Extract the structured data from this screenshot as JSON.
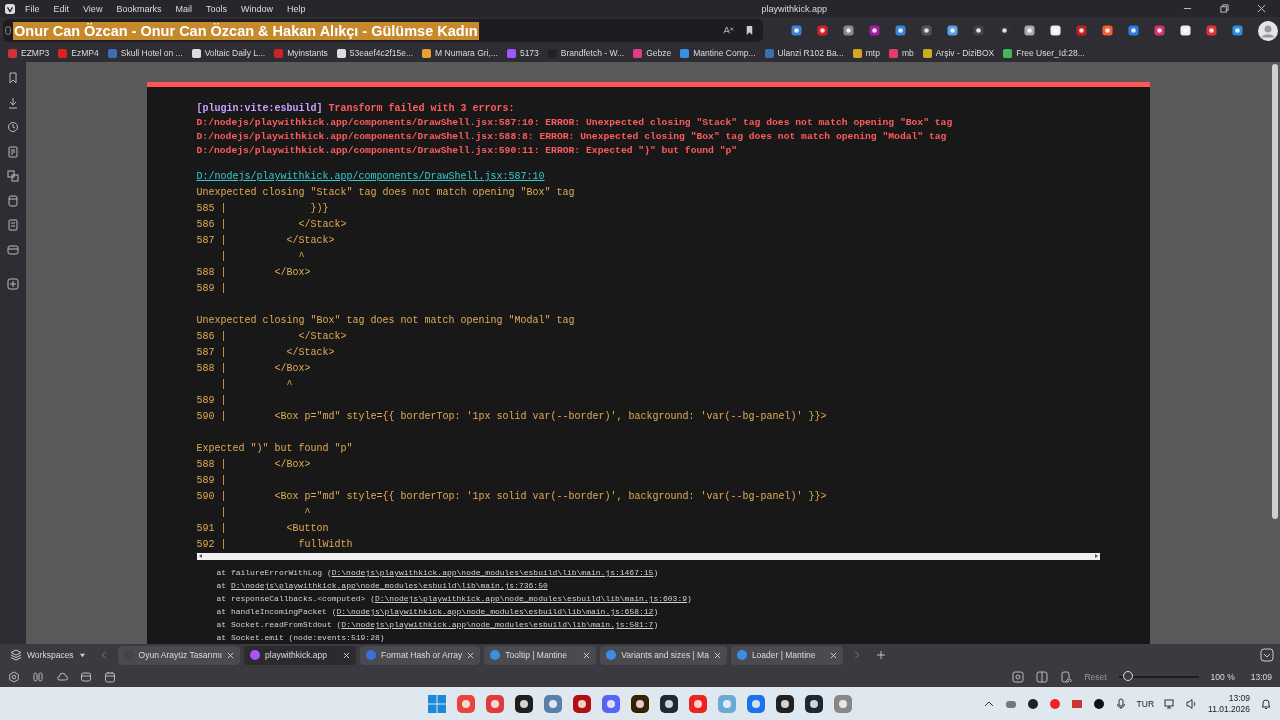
{
  "menu": [
    "File",
    "Edit",
    "View",
    "Bookmarks",
    "Mail",
    "Tools",
    "Window",
    "Help"
  ],
  "window": {
    "title": "playwithkick.app"
  },
  "address": {
    "value": "Onur Can Özcan - Onur Can Özcan & Hakan Alıkçı - Gülümse Kadın",
    "selected": true
  },
  "bookmarks": [
    "EZMP3",
    "EzMP4",
    "Skull Hotel on ...",
    "Voltaic Daily L...",
    "Myinstants",
    "53eaef4c2f15e...",
    "M Numara Gri,...",
    "5173",
    "Brandfetch - W...",
    "Gebze",
    "Mantine Comp...",
    "Ulanzi R102 Ba...",
    "mtp",
    "mb",
    "Arşiv - DiziBOX",
    "Free User_Id:28..."
  ],
  "error_overlay": {
    "plugin": "[plugin:vite:esbuild]",
    "message": "Transform failed with 3 errors:",
    "errors": [
      "D:/nodejs/playwithkick.app/components/DrawShell.jsx:587:10: ERROR: Unexpected closing \"Stack\" tag does not match opening \"Box\" tag",
      "D:/nodejs/playwithkick.app/components/DrawShell.jsx:588:8: ERROR: Unexpected closing \"Box\" tag does not match opening \"Modal\" tag",
      "D:/nodejs/playwithkick.app/components/DrawShell.jsx:590:11: ERROR: Expected \")\" but found \"p\""
    ],
    "file": "D:/nodejs/playwithkick.app/components/DrawShell.jsx:587:10",
    "frames": [
      {
        "message": "Unexpected closing \"Stack\" tag does not match opening \"Box\" tag",
        "lines": [
          "585 |              })}",
          "586 |            </Stack>",
          "587 |          </Stack>",
          "    |            ^",
          "588 |        </Box>",
          "589 |"
        ]
      },
      {
        "message": "Unexpected closing \"Box\" tag does not match opening \"Modal\" tag",
        "lines": [
          "586 |            </Stack>",
          "587 |          </Stack>",
          "588 |        </Box>",
          "    |          ^",
          "589 |",
          "590 |        <Box p=\"md\" style={{ borderTop: '1px solid var(--border)', background: 'var(--bg-panel)' }}>"
        ]
      },
      {
        "message": "Expected \")\" but found \"p\"",
        "lines": [
          "588 |        </Box>",
          "589 |",
          "590 |        <Box p=\"md\" style={{ borderTop: '1px solid var(--border)', background: 'var(--bg-panel)' }}>",
          "    |             ^",
          "591 |          <Button",
          "592 |            fullWidth"
        ]
      }
    ],
    "stack": [
      {
        "prefix": "at failureErrorWithLog (",
        "link": "D:\\nodejs\\playwithkick.app\\node_modules\\esbuild\\lib\\main.js:1467:15",
        "suffix": ")"
      },
      {
        "prefix": "at ",
        "link": "D:\\nodejs\\playwithkick.app\\node_modules\\esbuild\\lib\\main.js:736:50"
      },
      {
        "prefix": "at responseCallbacks.<computed> (",
        "link": "D:\\nodejs\\playwithkick.app\\node_modules\\esbuild\\lib\\main.js:603:9",
        "suffix": ")"
      },
      {
        "prefix": "at handleIncomingPacket (",
        "link": "D:\\nodejs\\playwithkick.app\\node_modules\\esbuild\\lib\\main.js:658:12",
        "suffix": ")"
      },
      {
        "prefix": "at Socket.readFromStdout (",
        "link": "D:\\nodejs\\playwithkick.app\\node_modules\\esbuild\\lib\\main.js:581:7",
        "suffix": ")"
      },
      {
        "prefix": "at Socket.emit (node:events:519:28)"
      }
    ]
  },
  "tabs": {
    "workspaces": "Workspaces",
    "items": [
      {
        "title": "Oyun Arayüz Tasarımı",
        "selected": false
      },
      {
        "title": "playwithkick.app",
        "selected": true
      },
      {
        "title": "Format Hash or Array",
        "selected": false
      },
      {
        "title": "Tooltip | Mantine",
        "selected": false
      },
      {
        "title": "Variants and sizes | Ma",
        "selected": false
      },
      {
        "title": "Loader | Mantine",
        "selected": false
      }
    ]
  },
  "status_bar": {
    "reset": "Reset",
    "zoom_slider": {
      "level": 0.12
    },
    "zoom": "100 %",
    "clock": "13:09"
  },
  "taskbar": {
    "language": "TUR",
    "time": "13:09",
    "date": "11.01.2026"
  }
}
